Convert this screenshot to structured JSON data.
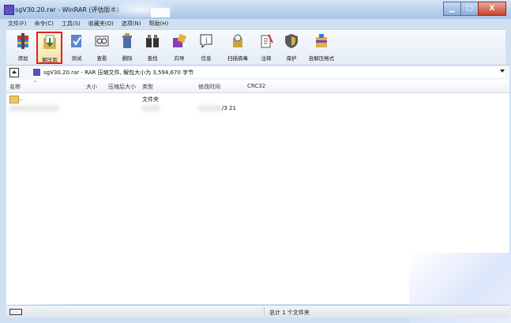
{
  "window": {
    "title": "sgV30.20.rar - WinRAR (评估版本)",
    "buttons": {
      "minimize": "▁",
      "maximize": "□",
      "close": "X"
    }
  },
  "menu": [
    "文件(F)",
    "命令(C)",
    "工具(S)",
    "收藏夹(O)",
    "选项(N)",
    "帮助(H)"
  ],
  "toolbar": [
    {
      "label": "添加",
      "icon": "add-archive-icon"
    },
    {
      "label": "解压到",
      "icon": "extract-to-icon"
    },
    {
      "label": "测试",
      "icon": "test-icon"
    },
    {
      "label": "查看",
      "icon": "view-icon"
    },
    {
      "label": "删除",
      "icon": "delete-icon"
    },
    {
      "label": "查找",
      "icon": "find-icon"
    },
    {
      "label": "向导",
      "icon": "wizard-icon"
    },
    {
      "label": "信息",
      "icon": "info-icon"
    },
    {
      "label": "扫描病毒",
      "icon": "scan-virus-icon"
    },
    {
      "label": "注释",
      "icon": "comment-icon"
    },
    {
      "label": "保护",
      "icon": "protect-icon"
    },
    {
      "label": "自解压格式",
      "icon": "sfx-icon"
    }
  ],
  "address": {
    "text": "sgV30.20.rar - RAR 压缩文件, 解包大小为 3,594,670 字节"
  },
  "columns": [
    "名称",
    "大小",
    "压缩后大小",
    "类型",
    "修改时间",
    "CRC32"
  ],
  "rows": [
    {
      "name": "..",
      "size": "",
      "packed": "",
      "type": "文件夹",
      "modified": "",
      "crc": ""
    },
    {
      "name": "",
      "size": "",
      "packed": "",
      "type": "",
      "modified": "/3 21",
      "crc": ""
    }
  ],
  "status": {
    "left": "",
    "right": "总计 1 个文件夹"
  }
}
